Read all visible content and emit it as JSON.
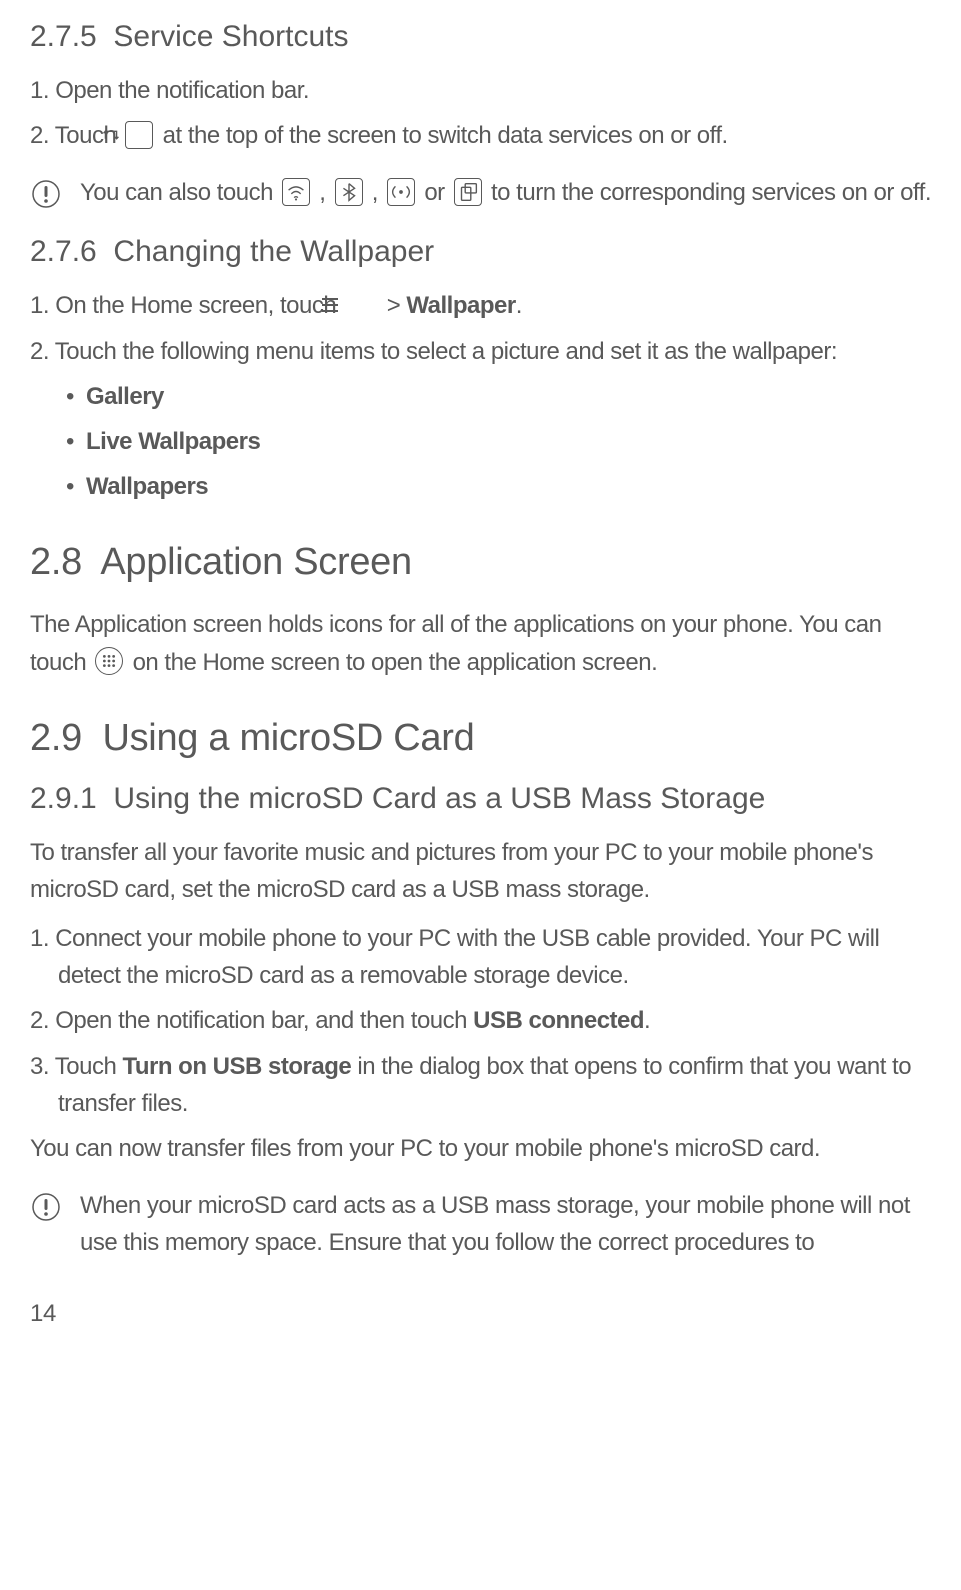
{
  "h275": {
    "num": "2.7.5",
    "title": "Service Shortcuts"
  },
  "step275_1": {
    "num": "1.",
    "text": "Open the notification bar."
  },
  "step275_2": {
    "num": "2.",
    "pre": "Touch",
    "post": "at the top of the screen to switch data services on or off."
  },
  "note275": {
    "pre": "You can also touch",
    "sep1": ",",
    "sep2": ",",
    "sep3": "or",
    "post": "to turn the corresponding services on or off."
  },
  "h276": {
    "num": "2.7.6",
    "title": "Changing the Wallpaper"
  },
  "step276_1": {
    "num": "1.",
    "pre": "On the Home screen, touch",
    "mid": ">",
    "bold": "Wallpaper",
    "post": "."
  },
  "step276_2": {
    "num": "2.",
    "text": "Touch the following menu items to select a picture and set it as the wallpaper:"
  },
  "bullets276": {
    "a": "Gallery",
    "b": "Live Wallpapers",
    "c": "Wallpapers"
  },
  "h28": {
    "num": "2.8",
    "title": "Application Screen"
  },
  "p28": {
    "pre": "The Application screen holds icons for all of the applications on your phone. You can touch",
    "post": "on the Home screen to open the application screen."
  },
  "h29": {
    "num": "2.9",
    "title": "Using a microSD Card"
  },
  "h291": {
    "num": "2.9.1",
    "title": "Using the microSD Card as a USB Mass Storage"
  },
  "p291": "To transfer all your favorite music and pictures from your PC to your mobile phone's microSD card, set the microSD card as a USB mass storage.",
  "step291_1": {
    "num": "1.",
    "text": "Connect your mobile phone to your PC with the USB cable provided. Your PC will detect the microSD card as a removable storage device."
  },
  "step291_2": {
    "num": "2.",
    "pre": "Open the notification bar, and then touch ",
    "bold": "USB connected",
    "post": "."
  },
  "step291_3": {
    "num": "3.",
    "pre": "Touch ",
    "bold": "Turn on USB storage",
    "post": " in the dialog box that opens to confirm that you want to transfer files."
  },
  "p291b": "You can now transfer files from your PC to your mobile phone's microSD card.",
  "note291": "When your microSD card acts as a USB mass storage, your mobile phone will not use this memory space. Ensure that you follow the correct procedures to",
  "pageNum": "14"
}
